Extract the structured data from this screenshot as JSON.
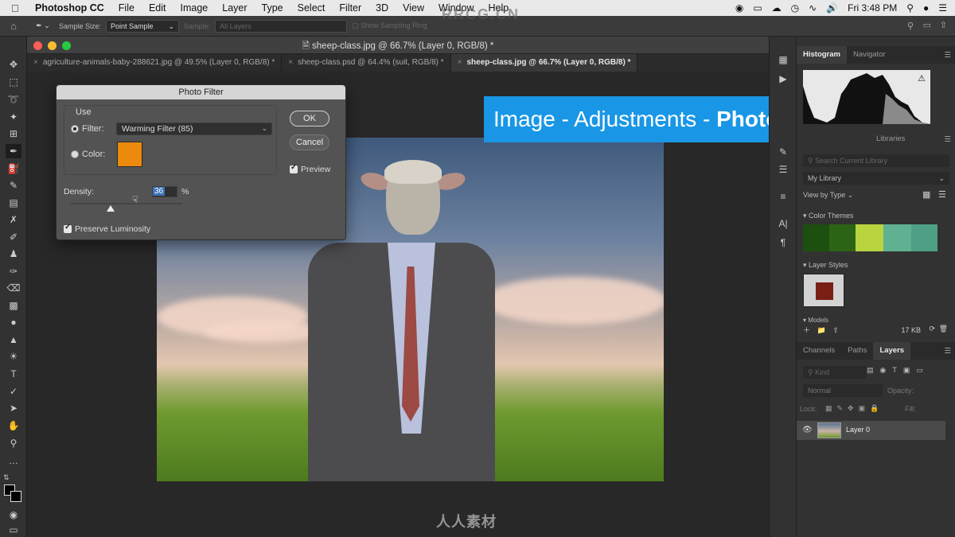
{
  "menubar": {
    "app": "Photoshop CC",
    "items": [
      "File",
      "Edit",
      "Image",
      "Layer",
      "Type",
      "Select",
      "Filter",
      "3D",
      "View",
      "Window",
      "Help"
    ],
    "clock": "Fri 3:48 PM"
  },
  "options": {
    "sample_size_label": "Sample Size:",
    "sample_size_value": "Point Sample",
    "sample_label": "Sample:",
    "sample_value": "All Layers",
    "show_ring": "Show Sampling Ring"
  },
  "document": {
    "title": "sheep-class.jpg @ 66.7% (Layer 0, RGB/8) *",
    "tabs": [
      {
        "label": "agriculture-animals-baby-288621.jpg @ 49.5% (Layer 0, RGB/8) *",
        "active": false
      },
      {
        "label": "sheep-class.psd @ 64.4% (suit, RGB/8) *",
        "active": false
      },
      {
        "label": "sheep-class.jpg @ 66.7% (Layer 0, RGB/8) *",
        "active": true
      }
    ]
  },
  "dialog": {
    "title": "Photo Filter",
    "use_label": "Use",
    "filter_label": "Filter:",
    "filter_value": "Warming Filter (85)",
    "color_label": "Color:",
    "color_value": "#ec8a0e",
    "ok_label": "OK",
    "cancel_label": "Cancel",
    "preview_label": "Preview",
    "density_label": "Density:",
    "density_value": "36",
    "density_unit": "%",
    "density_fraction": 0.36,
    "preserve_label": "Preserve Luminosity"
  },
  "caption": {
    "prefix": "Image - Adjustments - ",
    "bold": "Photo Filter"
  },
  "panels": {
    "top_tabs": [
      "Histogram",
      "Navigator"
    ],
    "libraries_tab": "Libraries",
    "search_placeholder": "Search Current Library",
    "library_select": "My Library",
    "view_by": "View by Type",
    "color_themes_label": "Color Themes",
    "theme_colors": [
      "#1d4f10",
      "#2c6416",
      "#b8d43e",
      "#5fb191",
      "#4d9f86"
    ],
    "layer_styles_label": "Layer Styles",
    "models_label": "Models",
    "size_text": "17 KB",
    "layer_tabs": [
      "Channels",
      "Paths",
      "Layers"
    ],
    "kind_placeholder": "Kind",
    "blend_mode": "Normal",
    "opacity_label": "Opacity:",
    "lock_label": "Lock:",
    "fill_label": "Fill:",
    "layer_name": "Layer 0"
  },
  "watermark": {
    "top": "RRCG.CN",
    "bottom": "人人素材"
  }
}
